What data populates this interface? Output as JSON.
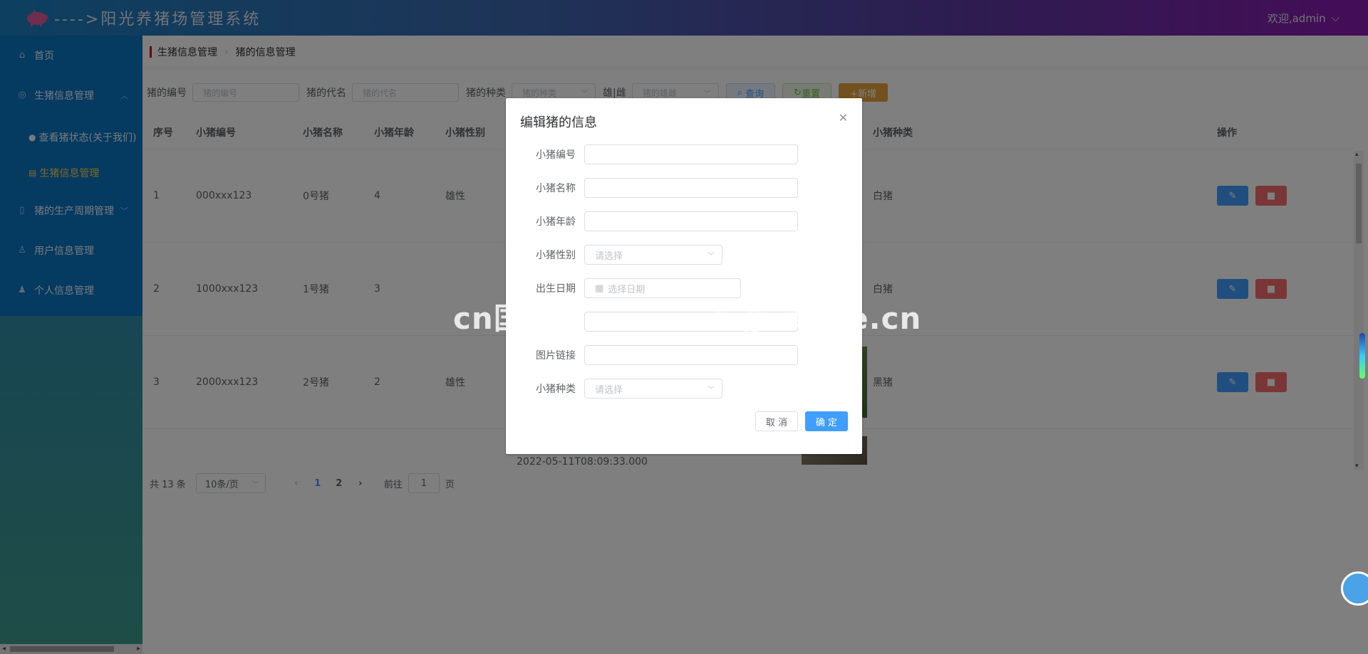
{
  "header": {
    "title": "---->阳光养猪场管理系统",
    "user": "欢迎,admin"
  },
  "sidebar": {
    "items": [
      {
        "label": "首页"
      },
      {
        "label": "生猪信息管理"
      },
      {
        "label": "查看猪状态(关于我们)"
      },
      {
        "label": "生猪信息管理"
      },
      {
        "label": "猪的生产周期管理"
      },
      {
        "label": "用户信息管理"
      },
      {
        "label": "个人信息管理"
      }
    ]
  },
  "breadcrumb": {
    "parent": "生猪信息管理",
    "current": "猪的信息管理"
  },
  "filters": {
    "code_label": "猪的编号",
    "code_placeholder": "猪的编号",
    "name_label": "猪的代名",
    "name_placeholder": "猪的代名",
    "type_label": "猪的种类",
    "type_placeholder": "猪的种类",
    "sex_label": "雄|雌",
    "sex_placeholder": "猪的雄雌",
    "query": "查询",
    "reset": "重置",
    "add": "+新增"
  },
  "table": {
    "headers": {
      "index": "序号",
      "code": "小猪编号",
      "name": "小猪名称",
      "age": "小猪年龄",
      "sex": "小猪性别",
      "type": "小猪种类",
      "ops": "操作"
    },
    "rows": [
      {
        "index": "1",
        "code": "000xxx123",
        "name": "0号猪",
        "age": "4",
        "sex": "雄性",
        "type": "白猪"
      },
      {
        "index": "2",
        "code": "1000xxx123",
        "name": "1号猪",
        "age": "3",
        "sex": "",
        "type": "白猪"
      },
      {
        "index": "3",
        "code": "2000xxx123",
        "name": "2号猪",
        "age": "2",
        "sex": "雄性",
        "type": "黑猪"
      }
    ],
    "partial_date": "2022-05-11T08:09:33.000"
  },
  "pager": {
    "total": "共 13 条",
    "size": "10条/页",
    "p1": "1",
    "p2": "2",
    "goto": "前往",
    "goto_value": "1",
    "page_unit": "页"
  },
  "dialog": {
    "title": "编辑猪的信息",
    "fields": {
      "code": "小猪编号",
      "name": "小猪名称",
      "age": "小猪年龄",
      "sex": "小猪性别",
      "sex_placeholder": "请选择",
      "birth": "出生日期",
      "birth_placeholder": "选择日期",
      "image": "图片链接",
      "type": "小猪种类",
      "type_placeholder": "请选择"
    },
    "cancel": "取 消",
    "ok": "确 定"
  },
  "watermark": "cn国观客www.weiguanke.cn",
  "colors": {
    "primary": "#409eff",
    "danger": "#f56c6c",
    "warning": "#e6a23c",
    "sidebar": "#0a74c2",
    "active_menu": "#ffd04b"
  }
}
